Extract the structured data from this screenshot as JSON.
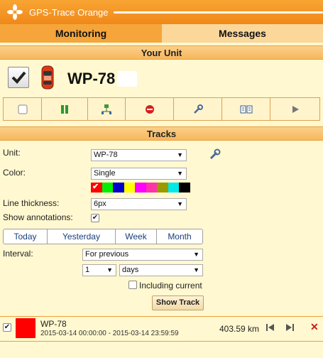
{
  "app": {
    "title": "GPS-Trace Orange"
  },
  "tabs": [
    {
      "label": "Monitoring",
      "active": true
    },
    {
      "label": "Messages",
      "active": false
    }
  ],
  "your_unit": {
    "heading": "Your Unit",
    "name": "WP-78",
    "checked": true
  },
  "toolbar_icons": [
    "checkbox-icon",
    "pause-icon",
    "network-icon",
    "stop-icon",
    "wrench-icon",
    "book-icon",
    "play-icon"
  ],
  "tracks": {
    "heading": "Tracks",
    "unit_label": "Unit:",
    "unit_value": "WP-78",
    "color_label": "Color:",
    "color_value": "Single",
    "palette": [
      "#ff0000",
      "#00ee00",
      "#0000cc",
      "#ffff00",
      "#ff00ff",
      "#ff33aa",
      "#999900",
      "#00e8e8",
      "#000000"
    ],
    "thickness_label": "Line thickness:",
    "thickness_value": "6px",
    "annotations_label": "Show annotations:",
    "annotations_checked": true,
    "period_buttons": [
      "Today",
      "Yesterday",
      "Week",
      "Month"
    ],
    "interval_label": "Interval:",
    "interval_value": "For previous",
    "count_value": "1",
    "unit_period_value": "days",
    "including_current_label": "Including current",
    "including_current_checked": false,
    "show_track_button": "Show Track"
  },
  "track_item": {
    "checked": true,
    "color": "#ff0000",
    "name": "WP-78",
    "dates": "2015-03-14 00:00:00 - 2015-03-14 23:59:59",
    "distance": "403.59 km"
  }
}
